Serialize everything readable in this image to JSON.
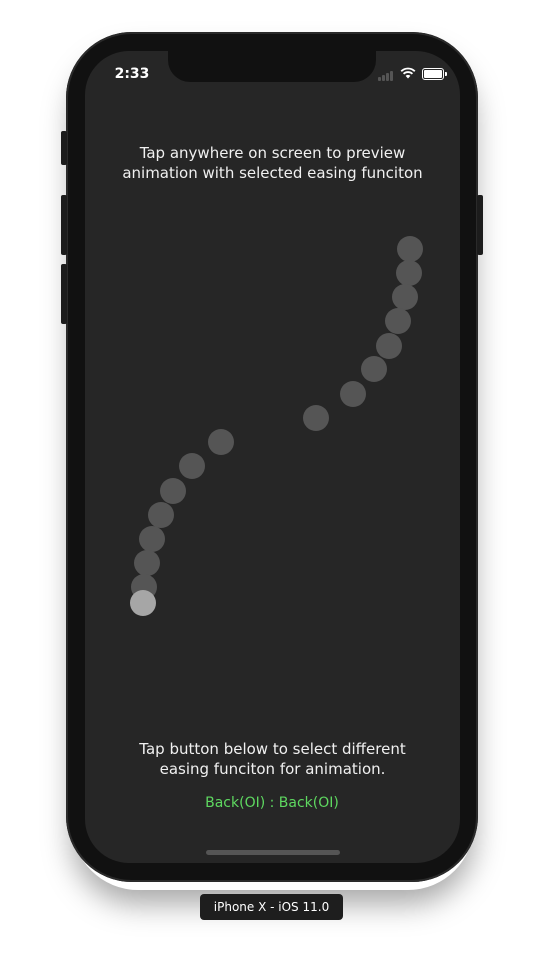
{
  "status_bar": {
    "time": "2:33",
    "icons": [
      "signal-icon",
      "wifi-icon",
      "battery-icon"
    ]
  },
  "top_instructions": {
    "line1": "Tap anywhere on screen to preview",
    "line2": "animation with selected easing funciton"
  },
  "bottom_instructions": {
    "line1": "Tap button below to select different",
    "line2": "easing funciton for animation."
  },
  "easing_button": {
    "label": "Back(OI) : Back(OI)",
    "color": "#5ed860"
  },
  "device_label": "iPhone X - iOS 11.0",
  "colors": {
    "screen_bg": "#262626",
    "trail_dot": "#555555",
    "active_dot": "#a6a6a6"
  }
}
